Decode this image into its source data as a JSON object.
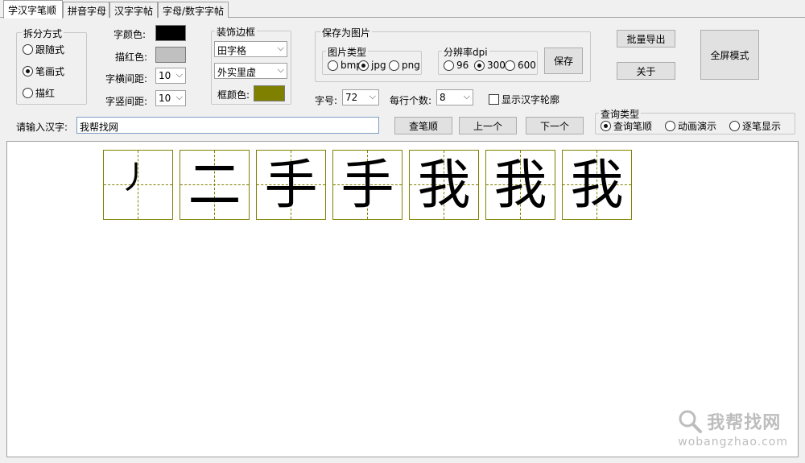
{
  "tabs": [
    "学汉字笔顺",
    "拼音字母",
    "汉字字帖",
    "字母/数字字帖"
  ],
  "split_mode": {
    "title": "拆分方式",
    "options": [
      "跟随式",
      "笔画式",
      "描红"
    ],
    "selected": "笔画式"
  },
  "colors": {
    "char_color_label": "字颜色:",
    "char_color": "#000000",
    "trace_color_label": "描红色:",
    "trace_color": "#c0c0c0",
    "h_spacing_label": "字横间距:",
    "h_spacing": "10",
    "v_spacing_label": "字竖间距:",
    "v_spacing": "10"
  },
  "border": {
    "title": "装饰边框",
    "grid_type": "田字格",
    "line_style": "外实里虚",
    "frame_color_label": "框颜色:",
    "frame_color": "#808000"
  },
  "save": {
    "title": "保存为图片",
    "image_type_title": "图片类型",
    "image_types": [
      "bmp",
      "jpg",
      "png"
    ],
    "image_type_selected": "jpg",
    "dpi_title": "分辨率dpi",
    "dpis": [
      "96",
      "300",
      "600"
    ],
    "dpi_selected": "300",
    "save_button": "保存"
  },
  "buttons": {
    "batch_export": "批量导出",
    "about": "关于",
    "fullscreen": "全屏模式",
    "lookup": "查笔顺",
    "prev": "上一个",
    "next": "下一个"
  },
  "font_size_label": "字号:",
  "font_size": "72",
  "per_row_label": "每行个数:",
  "per_row": "8",
  "show_outline_label": "显示汉字轮廓",
  "input_label": "请输入汉字:",
  "input_value": "我帮找网",
  "query_type": {
    "title": "查询类型",
    "options": [
      "查询笔顺",
      "动画演示",
      "逐笔显示"
    ],
    "selected": "查询笔顺"
  },
  "stroke_cells": [
    "丿",
    "二",
    "手",
    "手",
    "我",
    "我",
    "我"
  ],
  "watermark": {
    "title": "我帮找网",
    "site": "wobangzhao.com"
  }
}
